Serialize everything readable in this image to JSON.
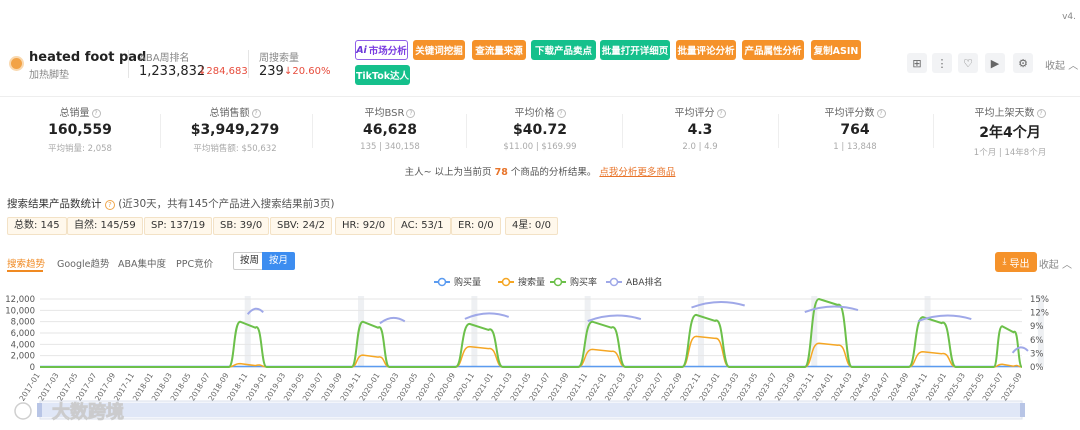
{
  "version": "v4.",
  "product": {
    "keyword": "heated foot pad",
    "translation": "加热脚垫",
    "aba_label": "ABA周排名",
    "aba_value": "1,233,832",
    "aba_delta": "↓284,683",
    "search_label": "周搜索量",
    "search_value": "239",
    "search_delta": "↓20.60%"
  },
  "tools": {
    "ai_badge": "Ai",
    "market": "市场分析",
    "keyword_mining": "关键词挖掘",
    "traffic_source": "查流量来源",
    "download_selling": "下载产品卖点",
    "batch_open": "批量打开详细页",
    "batch_review": "批量评论分析",
    "attr_analysis": "产品属性分析",
    "copy_asin": "复制ASIN",
    "tiktok": "TikTok达人",
    "collapse": "收起"
  },
  "stats": [
    {
      "label": "总销量",
      "value": "160,559",
      "sub": "平均销量: 2,058"
    },
    {
      "label": "总销售额",
      "value": "$3,949,279",
      "sub": "平均销售额: $50,632"
    },
    {
      "label": "平均BSR",
      "value": "46,628",
      "sub": "135 | 340,158"
    },
    {
      "label": "平均价格",
      "value": "$40.72",
      "sub": "$11.00 | $169.99"
    },
    {
      "label": "平均评分",
      "value": "4.3",
      "sub": "2.0 | 4.9"
    },
    {
      "label": "平均评分数",
      "value": "764",
      "sub": "1 | 13,848"
    },
    {
      "label": "平均上架天数",
      "value": "2年4个月",
      "sub": "1个月 | 14年8个月"
    }
  ],
  "note": {
    "prefix": "主人~ 以上为当前页",
    "count": "78",
    "suffix": "个商品的分析结果。",
    "link": "点我分析更多商品"
  },
  "search_stats": {
    "title": "搜索结果产品数统计",
    "desc": "(近30天，共有145个产品进入搜索结果前3页)",
    "chips": [
      "总数: 145",
      "自然: 145/59",
      "SP: 137/19",
      "SB: 39/0",
      "SBV: 24/2",
      "HR: 92/0",
      "AC: 53/1",
      "ER: 0/0",
      "4星: 0/0"
    ]
  },
  "trend_tabs": {
    "search_trend": "搜索趋势",
    "google_trend": "Google趋势",
    "aba_conc": "ABA集中度",
    "ppc": "PPC竞价",
    "by_week": "按周",
    "by_month": "按月",
    "export": "导出",
    "collapse": "收起"
  },
  "watermark": "大数跨境",
  "colors": {
    "orange": "#f5922a",
    "green": "#15c08c",
    "series_purchase": "#5b9bf0",
    "series_search": "#f5a623",
    "series_rate": "#6cc04a",
    "series_aba": "#9fa8e8"
  },
  "chart_data": {
    "type": "line",
    "legend": [
      "购买量",
      "搜索量",
      "购买率",
      "ABA排名"
    ],
    "legend_position": "top",
    "y_left_ticks": [
      "12,000",
      "10,000",
      "8,000",
      "6,000",
      "4,000",
      "2,000",
      "0"
    ],
    "y_right_ticks": [
      "15%",
      "12%",
      "9%",
      "6%",
      "3%",
      "0%"
    ],
    "ylim_left": [
      0,
      12000
    ],
    "ylim_right": [
      0,
      15
    ],
    "x_start": "2017-01",
    "x_end": "2025-09",
    "x_tick_step_months": 2,
    "seasons": [
      {
        "start": "2018-09",
        "end": "2019-01",
        "peak_rate": 10.0,
        "peak_search": 600
      },
      {
        "start": "2019-10",
        "end": "2020-02",
        "peak_rate": 10.0,
        "peak_search": 2100
      },
      {
        "start": "2020-09",
        "end": "2021-02",
        "peak_rate": 9.5,
        "peak_search": 3600
      },
      {
        "start": "2021-10",
        "end": "2022-03",
        "peak_rate": 10.0,
        "peak_search": 3100
      },
      {
        "start": "2022-09",
        "end": "2023-02",
        "peak_rate": 11.5,
        "peak_search": 5400
      },
      {
        "start": "2023-10",
        "end": "2024-03",
        "peak_rate": 15.0,
        "peak_search": 4200
      },
      {
        "start": "2024-09",
        "end": "2025-02",
        "peak_rate": 11.0,
        "peak_search": 2700
      },
      {
        "start": "2025-06",
        "end": "2025-09",
        "peak_rate": 9.0,
        "peak_search": 500
      }
    ],
    "aba_rank_segments": [
      {
        "start": "2018-11",
        "end": "2018-12",
        "level_pct": 12.5
      },
      {
        "start": "2020-01",
        "end": "2020-03",
        "level_pct": 10.5
      },
      {
        "start": "2020-10",
        "end": "2021-02",
        "level_pct": 11.5
      },
      {
        "start": "2021-11",
        "end": "2022-04",
        "level_pct": 11.0
      },
      {
        "start": "2022-10",
        "end": "2023-03",
        "level_pct": 14.0
      },
      {
        "start": "2023-10",
        "end": "2024-03",
        "level_pct": 13.0
      },
      {
        "start": "2024-10",
        "end": "2025-03",
        "level_pct": 11.0
      },
      {
        "start": "2025-08",
        "end": "2025-09",
        "level_pct": 4.0
      }
    ]
  }
}
